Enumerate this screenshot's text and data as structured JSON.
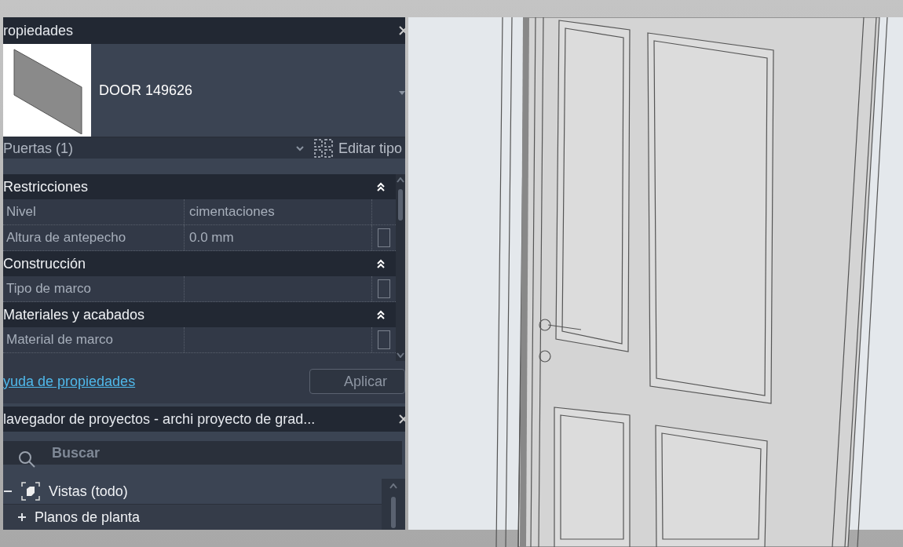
{
  "properties_panel": {
    "title": "ropiedades",
    "type_name": "DOOR 149626",
    "category": "Puertas (1)",
    "edit_type": "Editar tipo",
    "rows": [
      {
        "kind": "group",
        "label": "Restricciones",
        "expanded": true
      },
      {
        "kind": "param",
        "label": "Nivel",
        "value": "cimentaciones",
        "association_box": false
      },
      {
        "kind": "param",
        "label": "Altura de antepecho",
        "value": "0.0 mm",
        "association_box": true
      },
      {
        "kind": "group",
        "label": "Construcción",
        "expanded": true
      },
      {
        "kind": "param",
        "label": "Tipo de marco",
        "association_box": true
      },
      {
        "kind": "group",
        "label": "Materiales y acabados",
        "expanded": true
      },
      {
        "kind": "param",
        "label": "Material de marco",
        "association_box": true
      }
    ],
    "help_link": "yuda de propiedades",
    "apply_button": "Aplicar"
  },
  "project_browser": {
    "title": "lavegador de proyectos - archi proyecto de grad...",
    "search": {
      "placeholder": "Buscar"
    },
    "tree": [
      {
        "label": "Vistas (todo)",
        "expanded": true,
        "children": [
          {
            "label": "Planos de planta",
            "expanded": false
          }
        ]
      }
    ]
  }
}
